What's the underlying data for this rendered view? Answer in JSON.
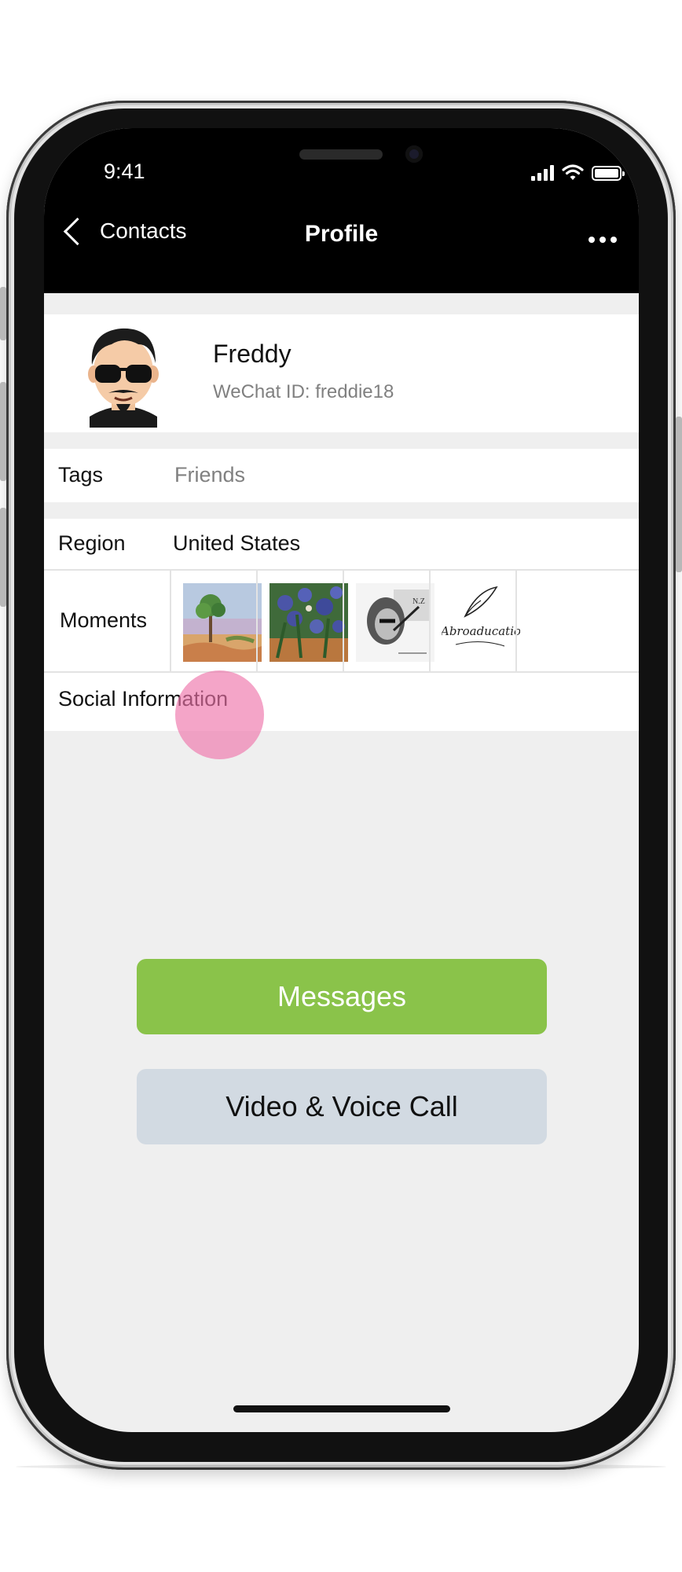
{
  "status_bar": {
    "time": "9:41"
  },
  "nav": {
    "back_label": "Contacts",
    "title": "Profile"
  },
  "profile": {
    "name": "Freddy",
    "wechat_id": "WeChat ID: freddie18"
  },
  "rows": {
    "tags": {
      "label": "Tags",
      "value": "Friends"
    },
    "region": {
      "label": "Region",
      "value": "United States"
    },
    "moments": {
      "label": "Moments"
    },
    "social": {
      "label": "Social Information"
    }
  },
  "moments_thumbnail": {
    "signature_text": "Abroaducatio"
  },
  "buttons": {
    "messages": "Messages",
    "call": "Video & Voice Call"
  },
  "colors": {
    "messages_button": "#8ac34a",
    "call_button": "#d2dae2",
    "touch_indicator": "#ee74aa",
    "nav_bar": "#000000"
  },
  "icons": [
    "chevron-left-icon",
    "more-dots-icon",
    "signal-icon",
    "wifi-icon",
    "battery-icon"
  ]
}
